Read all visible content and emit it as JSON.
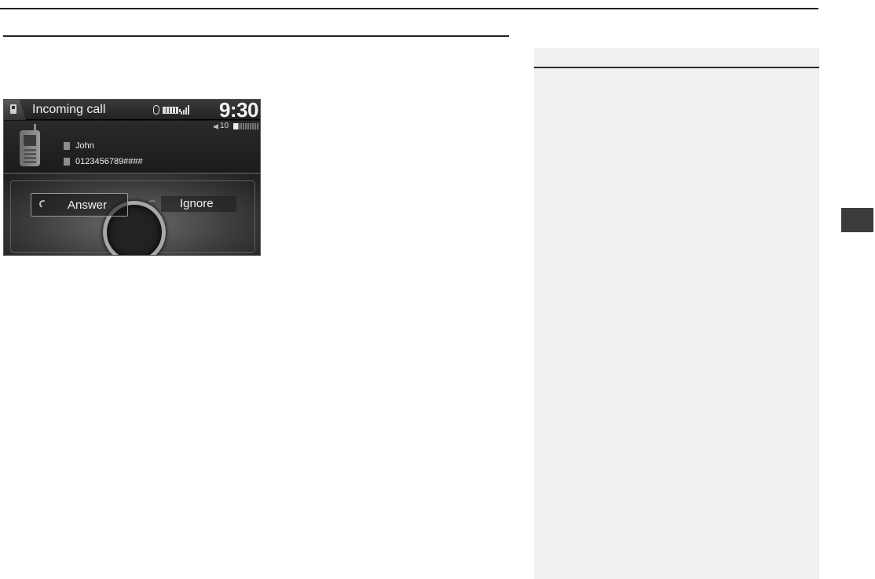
{
  "screen": {
    "title": "Incoming call",
    "clock": "9:30",
    "volume_value": "10",
    "contact_name": "John",
    "contact_number": "0123456789####"
  },
  "controls": {
    "answer_label": "Answer",
    "ignore_label": "Ignore"
  },
  "icons": {
    "phone_tab": "phone-icon",
    "bluetooth": "bluetooth-icon",
    "battery": "battery-icon",
    "signal": "signal-icon",
    "volume": "volume-icon",
    "handset": "handset-icon",
    "answer": "answer-call-icon",
    "ignore": "hang-up-icon"
  },
  "colors": {
    "screen_bg": "#141414",
    "side_panel": "#f1f1f1",
    "chapter_tab": "#3b3b3b"
  }
}
